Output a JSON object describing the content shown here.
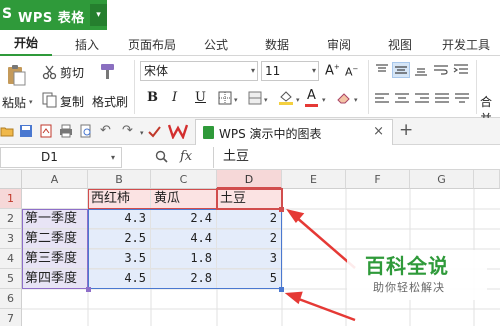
{
  "app": {
    "name": "WPS 表格",
    "menu_arrow": "▾"
  },
  "ribbon_tabs": [
    "开始",
    "插入",
    "页面布局",
    "公式",
    "数据",
    "审阅",
    "视图",
    "开发工具"
  ],
  "toolbar": {
    "paste_label": "粘贴",
    "cut_label": "剪切",
    "copy_label": "复制",
    "format_painter_label": "格式刷",
    "font_name": "宋体",
    "font_size": "11",
    "bold": "B",
    "italic": "I",
    "underline": "U",
    "merge_label": "合并"
  },
  "document": {
    "tab_name": "WPS 演示中的图表",
    "close": "×",
    "new_tab": "+"
  },
  "formula_bar": {
    "cell_ref": "D1",
    "zoom_icon": "search-icon",
    "fx": "fx",
    "content": "土豆"
  },
  "sheet": {
    "columns": [
      "A",
      "B",
      "C",
      "D",
      "E",
      "F",
      "G"
    ],
    "rows": [
      "1",
      "2",
      "3",
      "4",
      "5",
      "6",
      "7"
    ],
    "header_row": [
      "",
      "西红柿",
      "黄瓜",
      "土豆"
    ],
    "data_rows": [
      [
        "第一季度",
        "4.3",
        "2.4",
        "2"
      ],
      [
        "第二季度",
        "2.5",
        "4.4",
        "2"
      ],
      [
        "第三季度",
        "3.5",
        "1.8",
        "3"
      ],
      [
        "第四季度",
        "4.5",
        "2.8",
        "5"
      ]
    ],
    "selected_cell": "D1"
  },
  "watermark": {
    "title": "百科全说",
    "subtitle": "助你轻松解决"
  },
  "colors": {
    "brand_green": "#2f9a3a",
    "range_red": "#d14d4d",
    "range_purple": "#8e6fc9",
    "range_blue": "#4a78d0",
    "arrow_red": "#e53935"
  }
}
